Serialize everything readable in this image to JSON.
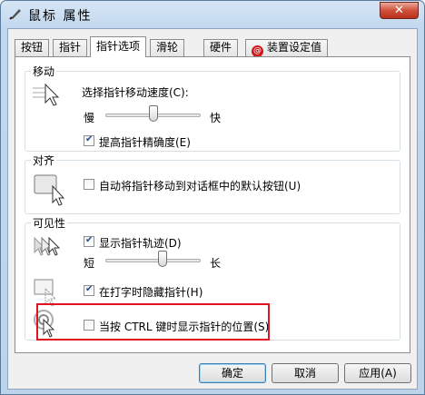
{
  "window": {
    "title": "鼠标 属性",
    "close_glyph": "✕"
  },
  "tabs": [
    {
      "label": "按钮"
    },
    {
      "label": "指针"
    },
    {
      "label": "指针选项"
    },
    {
      "label": "滑轮"
    },
    {
      "label": "硬件"
    },
    {
      "label": "装置设定值"
    }
  ],
  "motion": {
    "title": "移动",
    "speed_label": "选择指针移动速度(C):",
    "slow": "慢",
    "fast": "快",
    "speed_level": 0.5,
    "precision_label": "提高指针精确度(E)",
    "precision_checked": true
  },
  "snap": {
    "title": "对齐",
    "label": "自动将指针移动到对话框中的默认按钮(U)",
    "checked": false
  },
  "visibility": {
    "title": "可见性",
    "trails_label": "显示指针轨迹(D)",
    "trails_checked": true,
    "short": "短",
    "long": "长",
    "trail_level": 0.6,
    "hide_label": "在打字时隐藏指针(H)",
    "hide_checked": true,
    "ctrl_label": "当按 CTRL 键时显示指针的位置(S)",
    "ctrl_checked": false
  },
  "buttons": {
    "ok": "确定",
    "cancel": "取消",
    "apply": "应用(A)"
  },
  "icons": [
    "mouse-title-icon",
    "pointer-speed-icon",
    "snap-to-icon",
    "pointer-trails-icon",
    "hide-pointer-icon",
    "ctrl-locate-icon",
    "red-logo-icon"
  ],
  "colors": {
    "highlight": "#e0141e",
    "title_gradient": "#c2d8ee"
  }
}
